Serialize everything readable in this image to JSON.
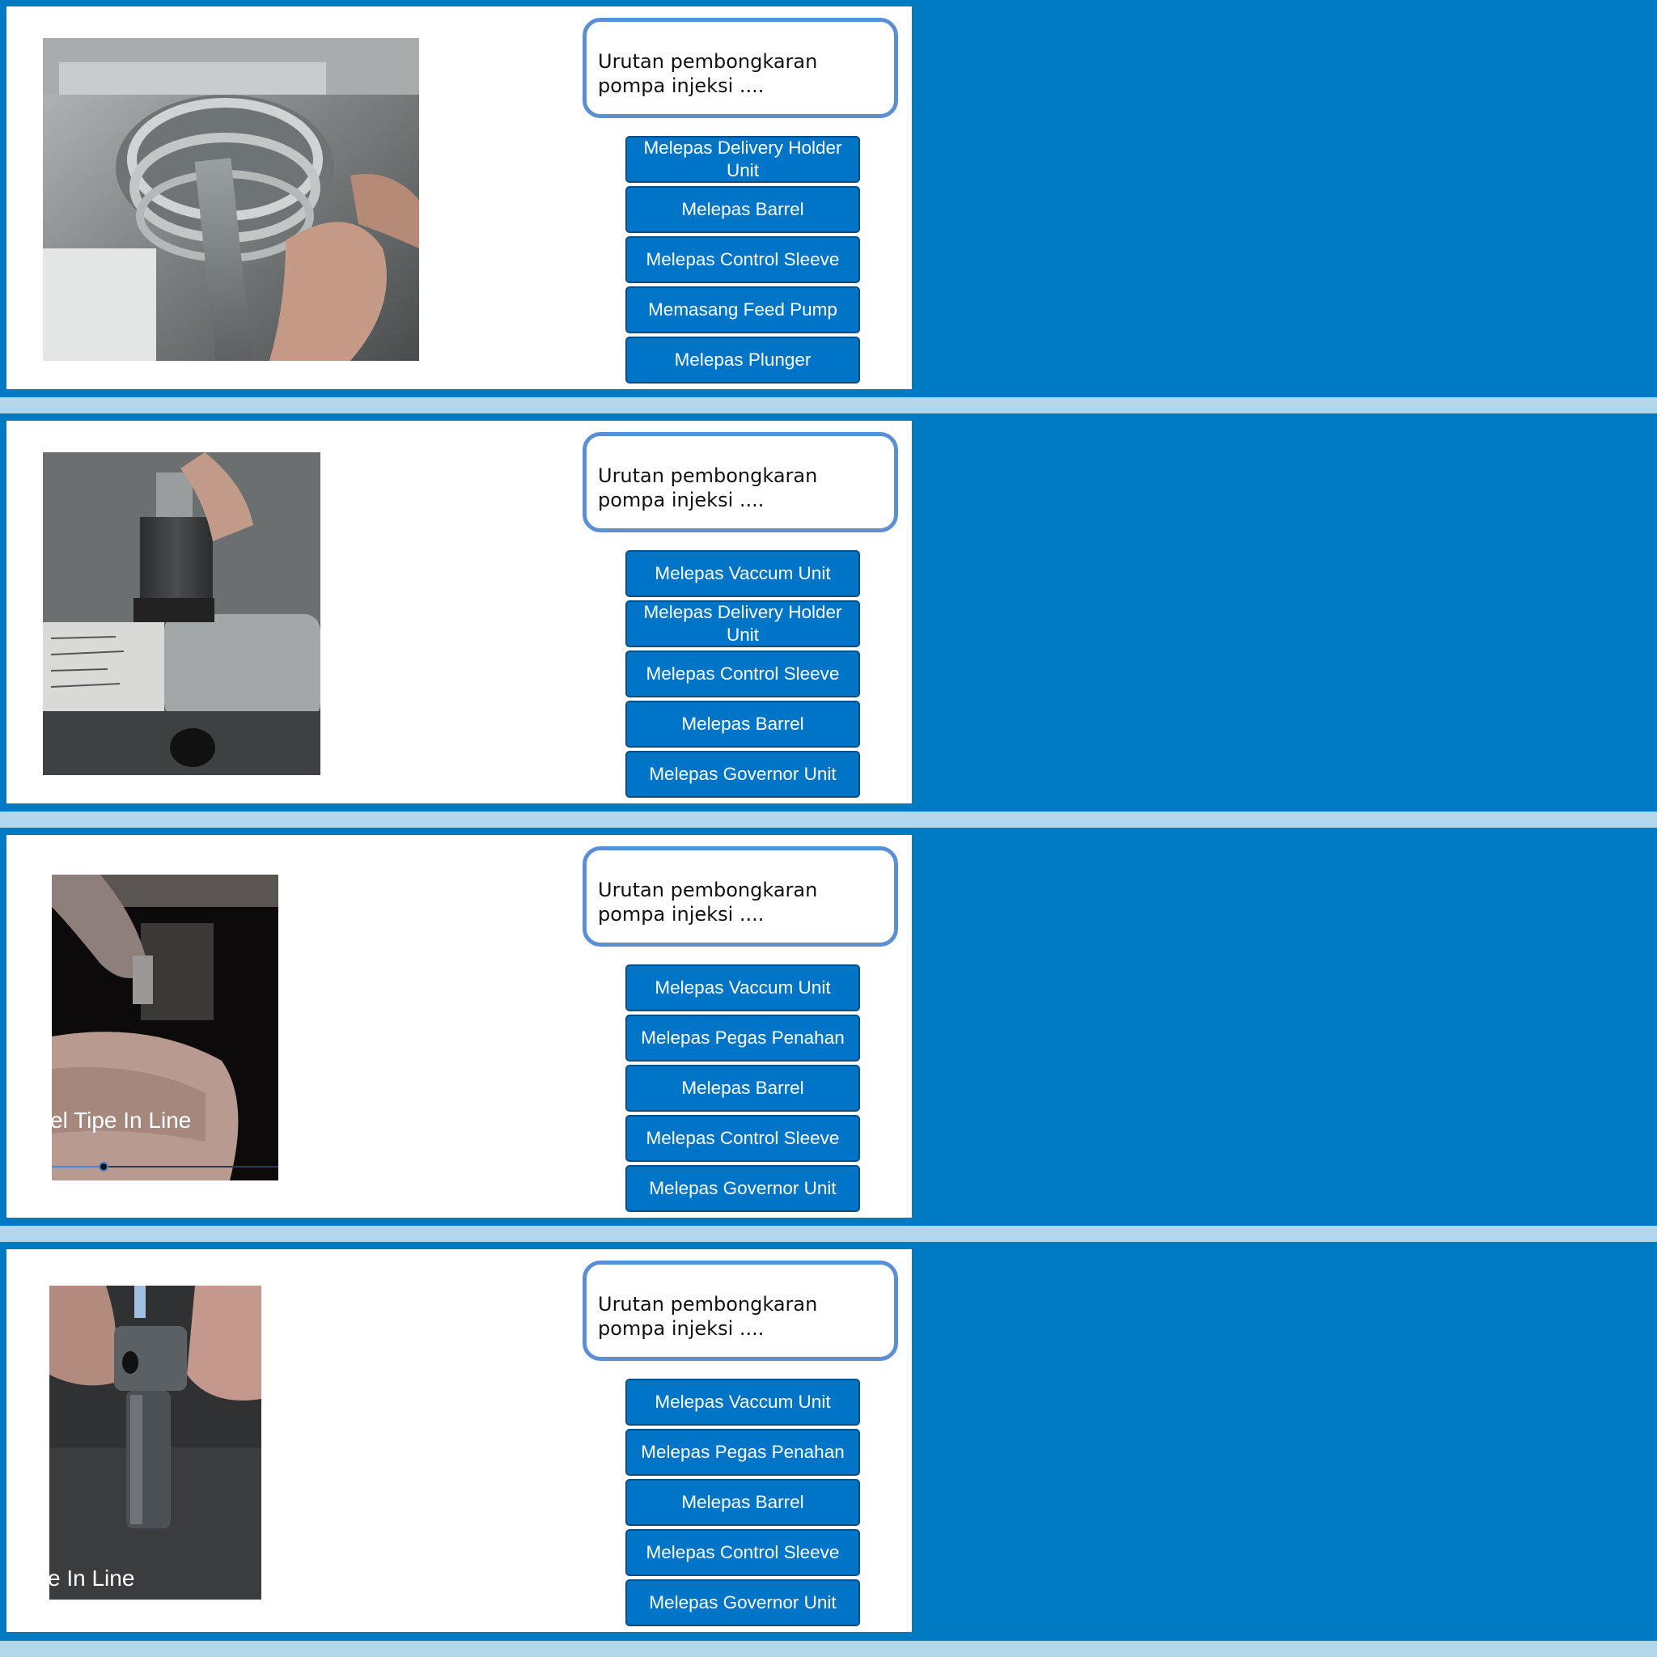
{
  "colors": {
    "background": "#007ac3",
    "separator": "#b3d7ea",
    "option_fill": "#0074c6",
    "question_border": "#5a8fd6"
  },
  "slides": [
    {
      "question": "Urutan pembongkaran pompa injeksi ....",
      "options": [
        "Melepas Delivery Holder Unit",
        "Melepas Barrel",
        "Melepas Control Sleeve",
        "Memasang Feed Pump",
        "Melepas Plunger"
      ]
    },
    {
      "question": "Urutan pembongkaran pompa injeksi ....",
      "options": [
        "Melepas Vaccum Unit",
        "Melepas Delivery Holder Unit",
        "Melepas Control Sleeve",
        "Melepas Barrel",
        "Melepas Governor Unit"
      ]
    },
    {
      "question": "Urutan pembongkaran pompa injeksi ....",
      "video_caption": "el Tipe In Line",
      "video_progress": 0.23,
      "options": [
        "Melepas Vaccum Unit",
        "Melepas Pegas Penahan",
        "Melepas Barrel",
        "Melepas Control Sleeve",
        "Melepas Governor Unit"
      ]
    },
    {
      "question": "Urutan pembongkaran pompa injeksi ....",
      "video_caption": "e In Line",
      "options": [
        "Melepas Vaccum Unit",
        "Melepas Pegas Penahan",
        "Melepas Barrel",
        "Melepas Control Sleeve",
        "Melepas Governor Unit"
      ]
    }
  ]
}
